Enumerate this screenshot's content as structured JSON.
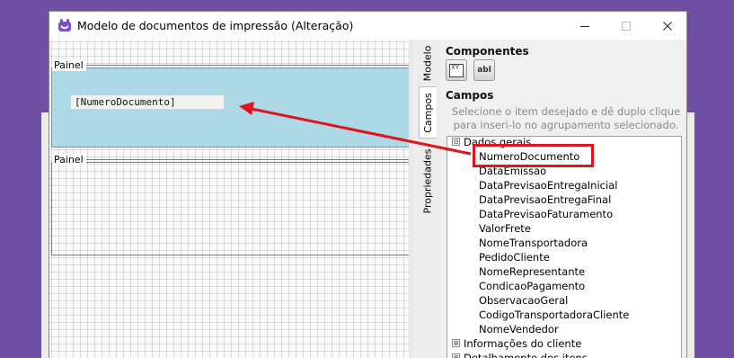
{
  "window": {
    "title": "Modelo de documentos de impressão (Alteração)",
    "icon": "app-logo-icon",
    "controls": [
      "minimize-icon",
      "maximize-icon",
      "close-icon"
    ]
  },
  "canvas": {
    "panels": [
      {
        "label": "Painel",
        "field": "[NumeroDocumento]",
        "background": "#add8e6"
      },
      {
        "label": "Painel"
      }
    ]
  },
  "tabs": [
    "Modelo",
    "Campos",
    "Propriedades"
  ],
  "active_tab": "Campos",
  "side": {
    "componentes_title": "Componentes",
    "components": [
      {
        "icon": "image-component-icon",
        "label": "XY"
      },
      {
        "icon": "text-component-icon",
        "label": "abl"
      }
    ],
    "campos_title": "Campos",
    "hint": "Selecione o item desejado e dê duplo clique para inseri-lo no agrupamento selecionado.",
    "tree": {
      "group_expanded": {
        "toggle": "⊟",
        "label": "Dados gerais"
      },
      "fields": [
        "NumeroDocumento",
        "DataEmissao",
        "DataPrevisaoEntregaInicial",
        "DataPrevisaoEntregaFinal",
        "DataPrevisaoFaturamento",
        "ValorFrete",
        "NomeTransportadora",
        "PedidoCliente",
        "NomeRepresentante",
        "CondicaoPagamento",
        "ObservacaoGeral",
        "CodigoTransportadoraCliente",
        "NomeVendedor"
      ],
      "collapsed_groups": [
        {
          "toggle": "⊞",
          "label": "Informações do cliente"
        },
        {
          "toggle": "⊞",
          "label": "Detalhamento dos itens"
        }
      ]
    }
  },
  "annotation": {
    "color": "#e0141e",
    "highlighted_field": "NumeroDocumento"
  }
}
